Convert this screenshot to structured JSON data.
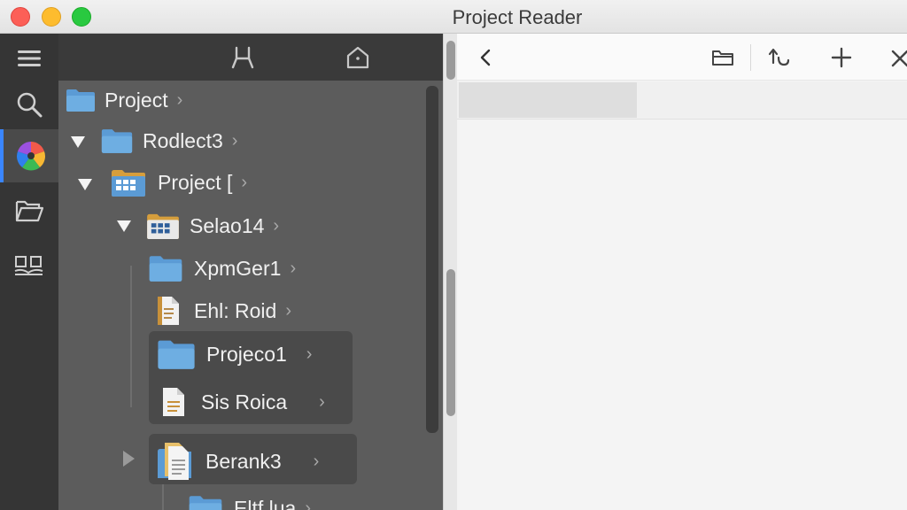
{
  "window": {
    "title": "Project Reader"
  },
  "rail": {
    "items": [
      {
        "icon": "menu-icon"
      },
      {
        "icon": "search-icon"
      },
      {
        "icon": "color-wheel-icon",
        "active": true
      },
      {
        "icon": "folder-open-icon"
      },
      {
        "icon": "library-icon"
      }
    ],
    "accent": "#3a86ff"
  },
  "sidebar": {
    "toolbar": [
      {
        "icon": "split-icon"
      },
      {
        "icon": "home-icon"
      }
    ],
    "tree": [
      {
        "label": "Project",
        "chevron": "›",
        "icon": "folder-icon"
      },
      {
        "label": "Rodlect3",
        "chevron": "›",
        "icon": "folder-icon",
        "expanded": true
      },
      {
        "label": "Project [",
        "chevron": "›",
        "icon": "grid-folder-icon",
        "expanded": true
      },
      {
        "label": "Selao14",
        "chevron": "›",
        "icon": "grid-folder-icon",
        "expanded": true
      },
      {
        "label": "XpmGer1",
        "chevron": "›",
        "icon": "folder-icon"
      },
      {
        "label": "Ehl: Roid",
        "chevron": "›",
        "icon": "document-icon"
      },
      {
        "label": "Projeco1",
        "chevron": "›",
        "icon": "folder-icon"
      },
      {
        "label": "Sis Roica",
        "chevron": "›",
        "icon": "document-icon"
      },
      {
        "label": "Berank3",
        "chevron": "›",
        "icon": "file-stack-icon",
        "expanded": false
      },
      {
        "label": "Eltf lua",
        "chevron": "›",
        "icon": "folder-icon"
      }
    ]
  },
  "main": {
    "toolbar": [
      {
        "icon": "back-icon"
      },
      {
        "icon": "folder-outline-icon"
      },
      {
        "icon": "undo-icon"
      },
      {
        "icon": "add-icon"
      },
      {
        "icon": "close-icon"
      }
    ]
  }
}
